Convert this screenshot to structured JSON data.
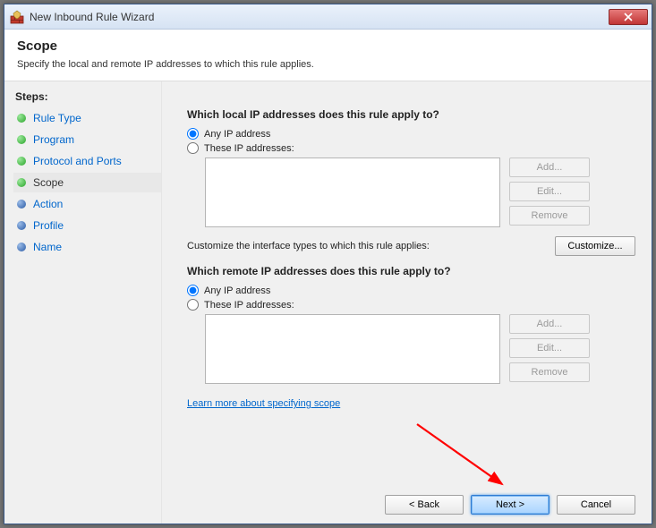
{
  "window": {
    "title": "New Inbound Rule Wizard"
  },
  "header": {
    "title": "Scope",
    "subtitle": "Specify the local and remote IP addresses to which this rule applies."
  },
  "sidebar": {
    "label": "Steps:",
    "items": [
      {
        "label": "Rule Type"
      },
      {
        "label": "Program"
      },
      {
        "label": "Protocol and Ports"
      },
      {
        "label": "Scope"
      },
      {
        "label": "Action"
      },
      {
        "label": "Profile"
      },
      {
        "label": "Name"
      }
    ],
    "current": 3
  },
  "content": {
    "local": {
      "question": "Which local IP addresses does this rule apply to?",
      "any_label": "Any IP address",
      "these_label": "These IP addresses:",
      "selected": "any"
    },
    "remote": {
      "question": "Which remote IP addresses does this rule apply to?",
      "any_label": "Any IP address",
      "these_label": "These IP addresses:",
      "selected": "any"
    },
    "customize_text": "Customize the interface types to which this rule applies:",
    "buttons": {
      "add": "Add...",
      "edit": "Edit...",
      "remove": "Remove",
      "customize": "Customize..."
    },
    "learn_link": "Learn more about specifying scope"
  },
  "footer": {
    "back": "< Back",
    "next": "Next >",
    "cancel": "Cancel"
  }
}
